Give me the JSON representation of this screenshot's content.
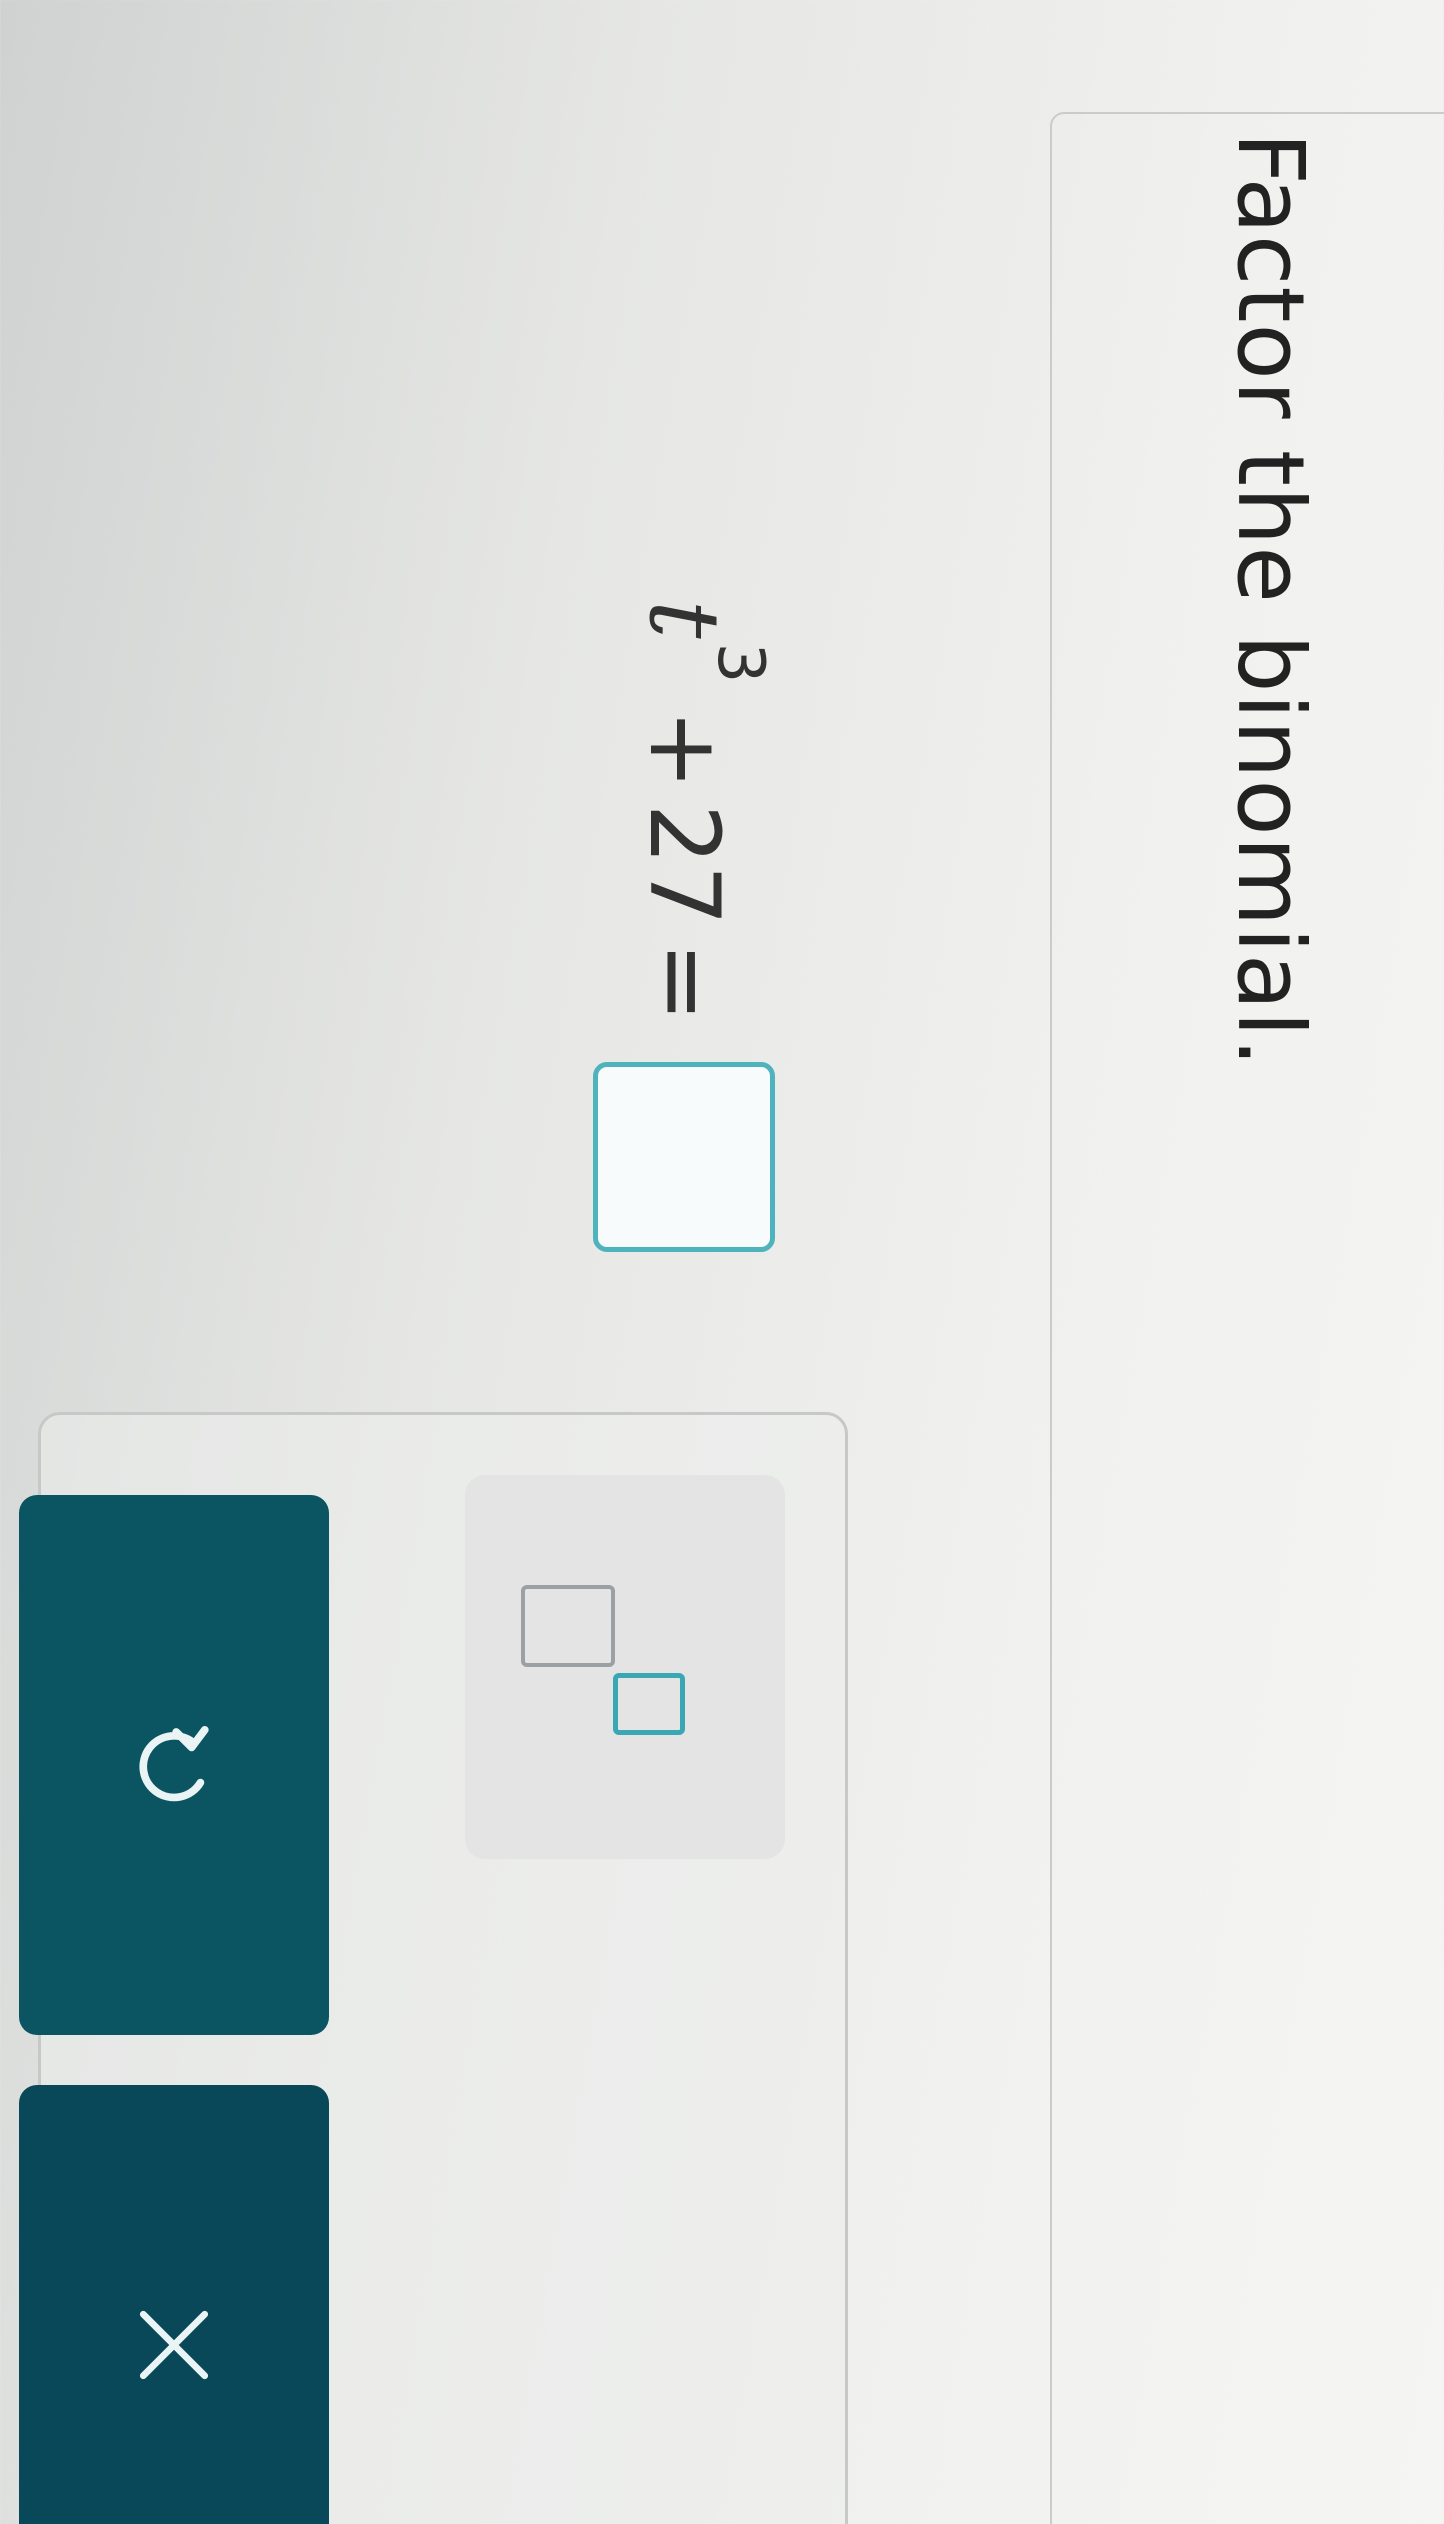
{
  "question": {
    "prompt": "Factor the binomial."
  },
  "equation": {
    "variable": "t",
    "exponent": "3",
    "operator": "+",
    "constant": "27",
    "equals": "="
  },
  "keypad": {
    "exponent_key_icon": "superscript-template-icon",
    "undo_icon": "undo-icon",
    "clear_icon": "close-icon"
  },
  "colors": {
    "accent": "#4fb3bd",
    "button_bg": "#0b5563"
  }
}
